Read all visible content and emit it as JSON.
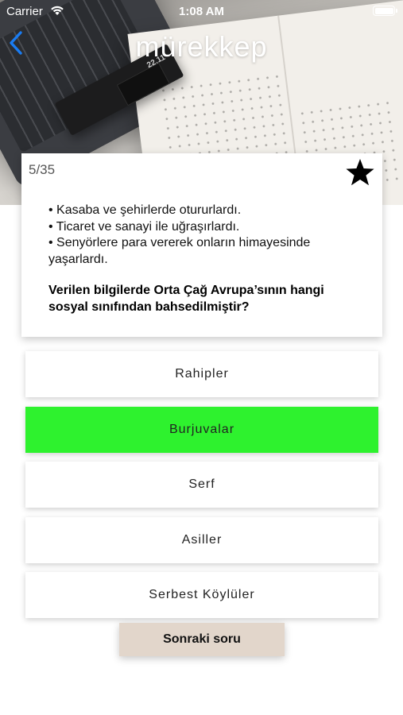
{
  "status_bar": {
    "carrier": "Carrier",
    "time": "1:08 AM"
  },
  "nav": {
    "title": "mürekkep",
    "back_icon": "chevron-left-icon",
    "accent_color": "#1a7cf2"
  },
  "header_image": {
    "pen_box_label": "22.11"
  },
  "question": {
    "counter": "5/35",
    "favorite_icon": "star-icon",
    "bullets": [
      "• Kasaba ve şehirlerde otururlardı.",
      "• Ticaret ve sanayi ile uğraşırlardı.",
      "• Senyörlere para vererek onların himayesinde yaşarlardı."
    ],
    "prompt": "Verilen bilgilerde Orta Çağ Avrupa’sının hangi sosyal sınıfından bahsedilmiştir?"
  },
  "options": [
    {
      "label": "Rahipler",
      "state": "default"
    },
    {
      "label": "Burjuvalar",
      "state": "correct"
    },
    {
      "label": "Serf",
      "state": "default"
    },
    {
      "label": "Asiller",
      "state": "default"
    },
    {
      "label": "Serbest Köylüler",
      "state": "default"
    }
  ],
  "next_button": {
    "label": "Sonraki soru",
    "color": "#e2d6cb"
  },
  "colors": {
    "correct_option": "#2ef22e"
  }
}
